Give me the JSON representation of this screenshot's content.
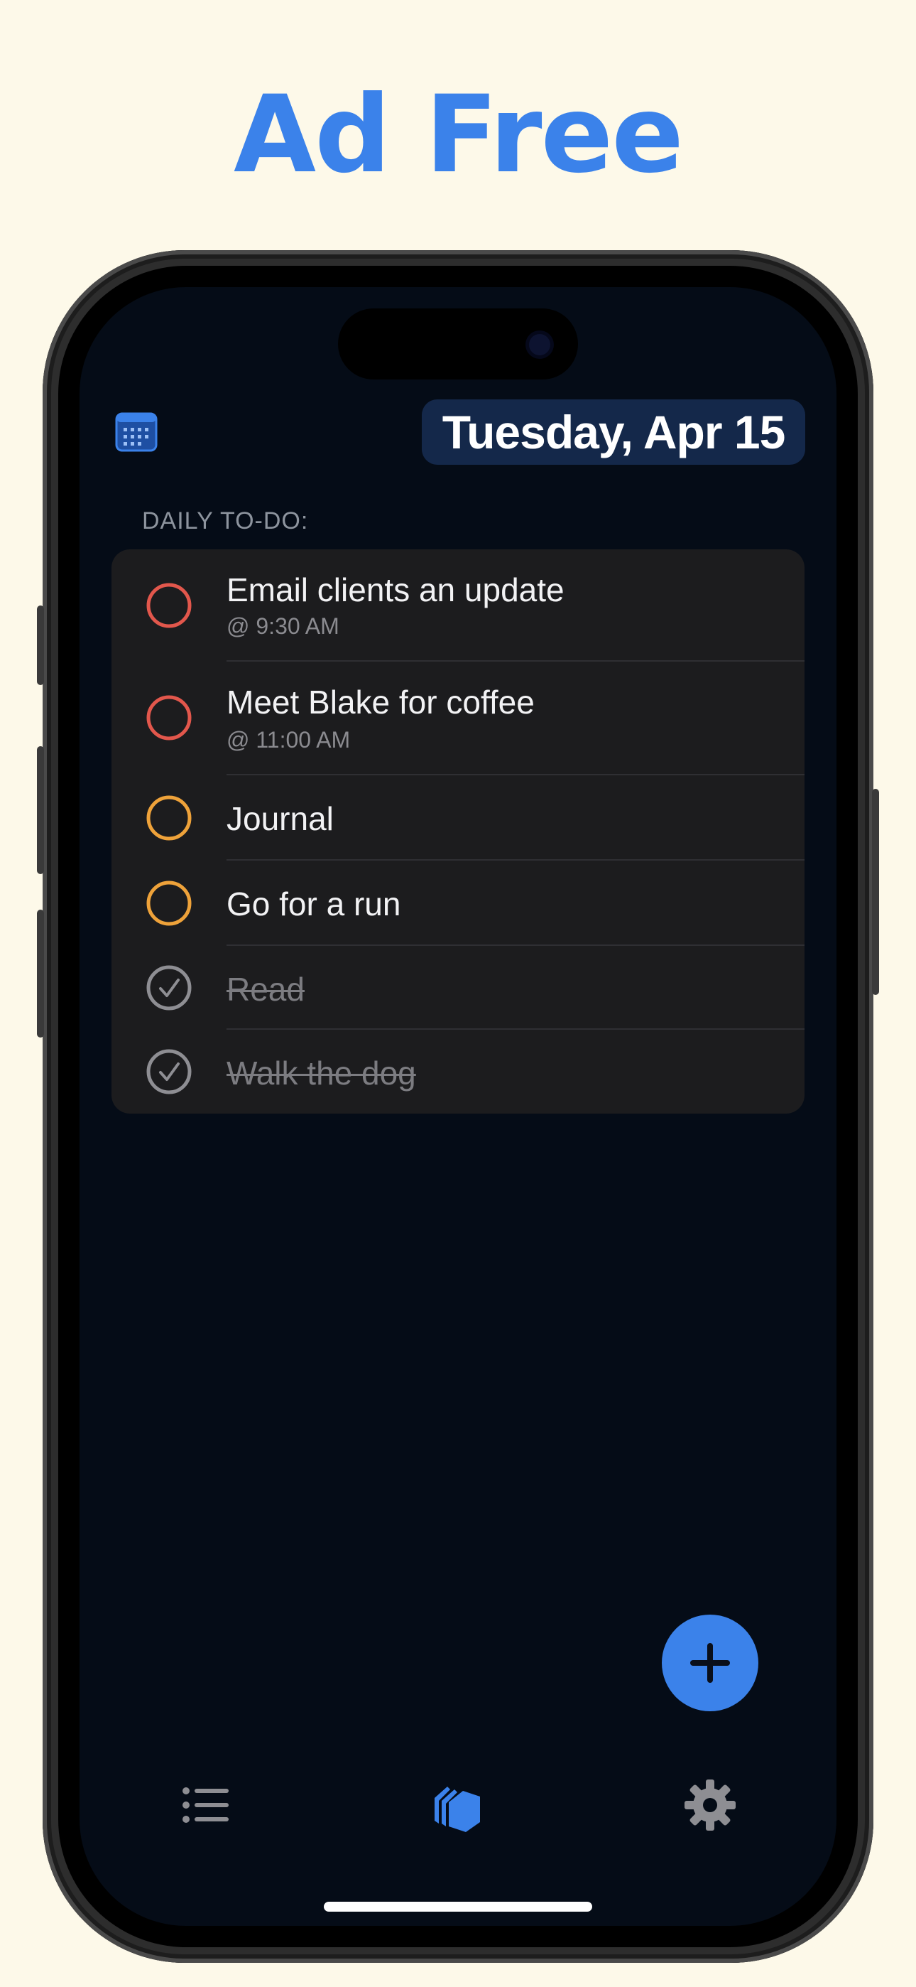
{
  "headline": "Ad Free",
  "header": {
    "date": "Tuesday, Apr 15",
    "calendar_icon": "calendar-icon"
  },
  "section": {
    "label": "DAILY TO-DO:"
  },
  "todos": [
    {
      "title": "Email clients an update",
      "time": "@ 9:30 AM",
      "status": "open",
      "color": "#e2574c"
    },
    {
      "title": "Meet Blake for coffee",
      "time": "@ 11:00 AM",
      "status": "open",
      "color": "#e2574c"
    },
    {
      "title": "Journal",
      "time": "",
      "status": "open",
      "color": "#eea23a"
    },
    {
      "title": "Go for a run",
      "time": "",
      "status": "open",
      "color": "#eea23a"
    },
    {
      "title": "Read",
      "time": "",
      "status": "done",
      "color": "#8e8e93"
    },
    {
      "title": "Walk the dog",
      "time": "",
      "status": "done",
      "color": "#8e8e93"
    }
  ],
  "fab": {
    "icon": "plus-icon"
  },
  "tabbar": {
    "items": [
      {
        "icon": "list-icon",
        "active": false
      },
      {
        "icon": "cards-icon",
        "active": true
      },
      {
        "icon": "gear-icon",
        "active": false
      }
    ]
  },
  "colors": {
    "accent": "#3b82ea",
    "background": "#fdf9e9",
    "screen": "#050c17",
    "card": "#1c1c1e"
  }
}
